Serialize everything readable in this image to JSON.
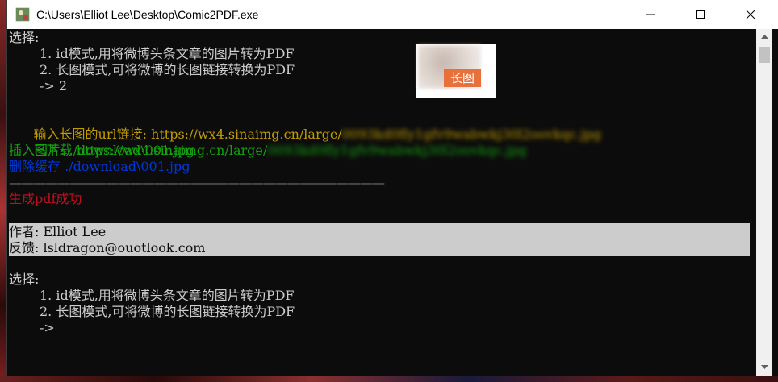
{
  "window": {
    "title": "C:\\Users\\Elliot Lee\\Desktop\\Comic2PDF.exe"
  },
  "menu1": {
    "prompt": "选择:",
    "option1": "1. id模式,用将微博头条文章的图片转为PDF",
    "option2": "2. 长图模式,可将微博的长图链接转换为PDF",
    "answer": "-> 2"
  },
  "thumbnail": {
    "badge": "长图"
  },
  "log": {
    "input_label": "输入长图的url链接: https://wx4.sinaimg.cn/large/",
    "input_blurred": "0093kd0fly1gfv9wabwkj30l2oovkqc.jpg",
    "downloaded_label": "已下载 https://wx4.sinaimg.cn/large/",
    "downloaded_blurred": "0093kd0fly1gfv9wabwkj30l2oovkqc.jpg",
    "inserted": "插入图片: ./download\\001.jpg",
    "deleted": "删除缓存 ./download\\001.jpg",
    "separator": "———————————————————————————————",
    "success": "生成pdf成功"
  },
  "author": {
    "author_line": "作者: Elliot Lee",
    "feedback_line": "反馈: lsldragon@ouotlook.com"
  },
  "menu2": {
    "prompt": "选择:",
    "option1": "1. id模式,用将微博头条文章的图片转为PDF",
    "option2": "2. 长图模式,可将微博的长图链接转换为PDF",
    "cursor": "->"
  },
  "colors": {
    "console_bg": "#0c0c0c",
    "gray": "#cccccc",
    "yellow": "#c19c00",
    "green": "#13a10e",
    "blue": "#0037da",
    "red": "#c50f1f",
    "badge": "#e8703a"
  },
  "icons": {
    "app": "app-icon",
    "minimize": "minimize-icon",
    "maximize": "maximize-icon",
    "close": "close-icon",
    "scroll_up": "scroll-up-arrow-icon",
    "scroll_down": "scroll-down-arrow-icon"
  }
}
